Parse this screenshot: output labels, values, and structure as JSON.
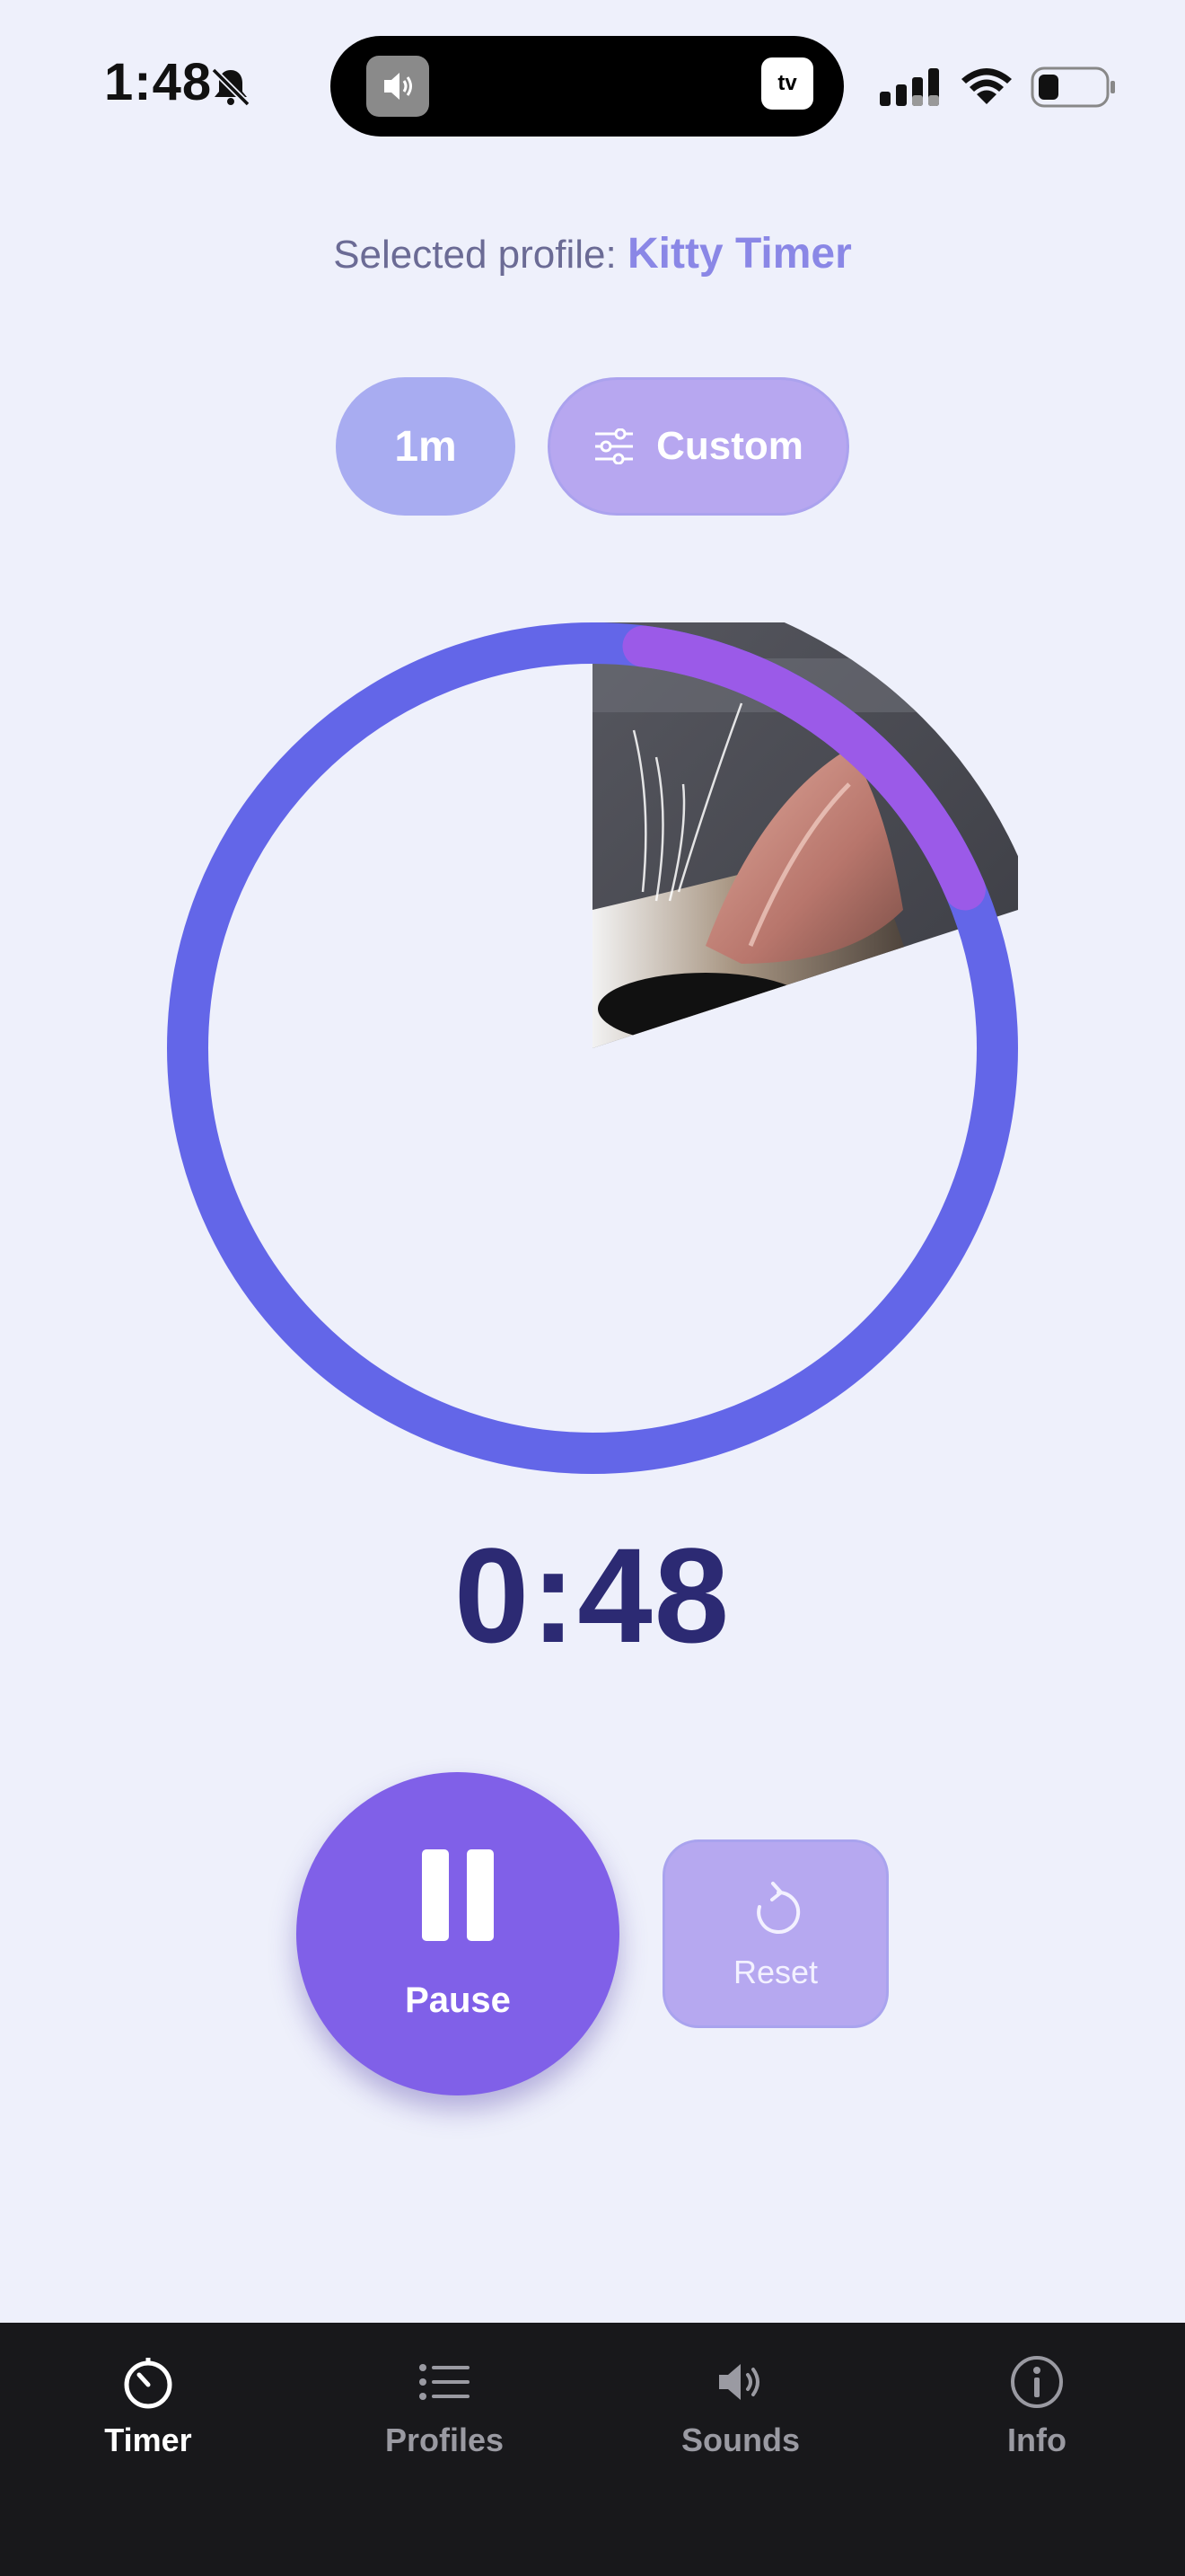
{
  "status_bar": {
    "time": "1:48",
    "island_right_label": "tv"
  },
  "profile": {
    "prefix": "Selected profile:",
    "name": "Kitty Timer"
  },
  "chips": {
    "preset": "1m",
    "custom": "Custom"
  },
  "timer": {
    "display": "0:48",
    "total_seconds": 60,
    "remaining_seconds": 48,
    "photo_revealed_fraction": 0.2
  },
  "controls": {
    "pause": "Pause",
    "reset": "Reset"
  },
  "tabbar": {
    "items": [
      {
        "label": "Timer",
        "icon": "stopwatch-icon",
        "active": true
      },
      {
        "label": "Profiles",
        "icon": "list-icon",
        "active": false
      },
      {
        "label": "Sounds",
        "icon": "speaker-icon",
        "active": false
      },
      {
        "label": "Info",
        "icon": "info-icon",
        "active": false
      }
    ]
  },
  "colors": {
    "ring": "#6366e8",
    "ring_progress": "#9b5ae8",
    "background": "#eef0fb",
    "accent": "#8060e8"
  }
}
